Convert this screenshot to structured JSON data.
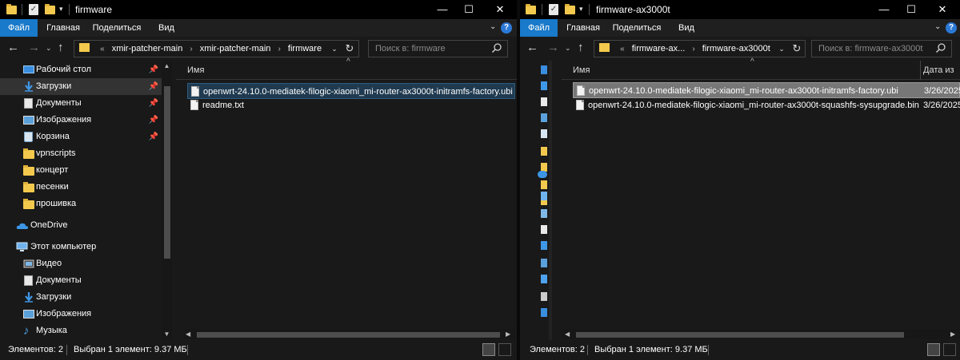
{
  "win1": {
    "title": "firmware",
    "ribbon": {
      "file": "Файл",
      "home": "Главная",
      "share": "Поделиться",
      "view": "Вид"
    },
    "breadcrumb": {
      "prefix": "«",
      "items": [
        "xmir-patcher-main",
        "xmir-patcher-main",
        "firmware"
      ]
    },
    "search_placeholder": "Поиск в: firmware",
    "nav": [
      {
        "label": "Рабочий стол",
        "icon": "desktop-icon",
        "pinned": true
      },
      {
        "label": "Загрузки",
        "icon": "downloads-icon",
        "pinned": true,
        "selected": true
      },
      {
        "label": "Документы",
        "icon": "documents-icon",
        "pinned": true
      },
      {
        "label": "Изображения",
        "icon": "pictures-icon",
        "pinned": true
      },
      {
        "label": "Корзина",
        "icon": "recycle-bin-icon",
        "pinned": true
      },
      {
        "label": "vpnscripts",
        "icon": "folder-icon"
      },
      {
        "label": "концерт",
        "icon": "folder-icon"
      },
      {
        "label": "песенки",
        "icon": "folder-icon"
      },
      {
        "label": "прошивка",
        "icon": "folder-icon"
      },
      {
        "label": "OneDrive",
        "icon": "onedrive-icon"
      },
      {
        "label": "Этот компьютер",
        "icon": "computer-icon"
      },
      {
        "label": "Видео",
        "icon": "videos-icon"
      },
      {
        "label": "Документы",
        "icon": "documents-icon"
      },
      {
        "label": "Загрузки",
        "icon": "downloads-icon"
      },
      {
        "label": "Изображения",
        "icon": "pictures-icon"
      },
      {
        "label": "Музыка",
        "icon": "music-icon"
      }
    ],
    "column_name": "Имя",
    "files": [
      {
        "name": "openwrt-24.10.0-mediatek-filogic-xiaomi_mi-router-ax3000t-initramfs-factory.ubi",
        "state": "hover"
      },
      {
        "name": "readme.txt",
        "state": "none"
      }
    ],
    "status": {
      "count": "Элементов: 2",
      "selection": "Выбран 1 элемент: 9.37 МБ"
    }
  },
  "win2": {
    "title": "firmware-ax3000t",
    "ribbon": {
      "file": "Файл",
      "home": "Главная",
      "share": "Поделиться",
      "view": "Вид"
    },
    "breadcrumb": {
      "prefix": "«",
      "items": [
        "firmware-ax...",
        "firmware-ax3000t"
      ]
    },
    "search_placeholder": "Поиск в: firmware-ax3000t",
    "column_name": "Имя",
    "column_date": "Дата из",
    "files": [
      {
        "name": "openwrt-24.10.0-mediatek-filogic-xiaomi_mi-router-ax3000t-initramfs-factory.ubi",
        "date": "3/26/2025",
        "state": "selected"
      },
      {
        "name": "openwrt-24.10.0-mediatek-filogic-xiaomi_mi-router-ax3000t-squashfs-sysupgrade.bin",
        "date": "3/26/2025",
        "state": "none"
      }
    ],
    "status": {
      "count": "Элементов: 2",
      "selection": "Выбран 1 элемент: 9.37 МБ"
    }
  },
  "colors": {
    "background": "#191919",
    "titlebar": "#000000",
    "file_tab": "#1979ca",
    "folder": "#f3c94d",
    "selection": "#777777",
    "nav_selected": "#333333"
  }
}
